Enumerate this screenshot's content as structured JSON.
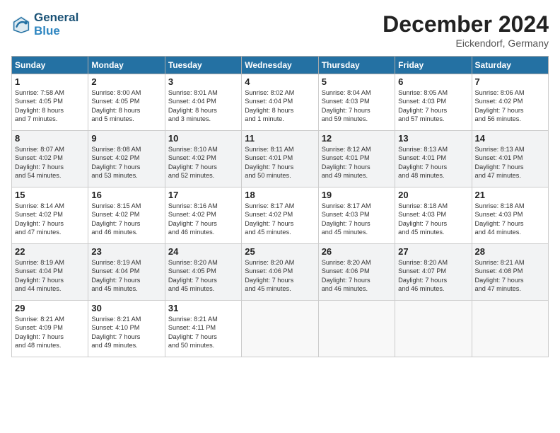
{
  "header": {
    "logo_line1": "General",
    "logo_line2": "Blue",
    "month": "December 2024",
    "location": "Eickendorf, Germany"
  },
  "days_of_week": [
    "Sunday",
    "Monday",
    "Tuesday",
    "Wednesday",
    "Thursday",
    "Friday",
    "Saturday"
  ],
  "weeks": [
    [
      {
        "day": 1,
        "info": "Sunrise: 7:58 AM\nSunset: 4:05 PM\nDaylight: 8 hours\nand 7 minutes."
      },
      {
        "day": 2,
        "info": "Sunrise: 8:00 AM\nSunset: 4:05 PM\nDaylight: 8 hours\nand 5 minutes."
      },
      {
        "day": 3,
        "info": "Sunrise: 8:01 AM\nSunset: 4:04 PM\nDaylight: 8 hours\nand 3 minutes."
      },
      {
        "day": 4,
        "info": "Sunrise: 8:02 AM\nSunset: 4:04 PM\nDaylight: 8 hours\nand 1 minute."
      },
      {
        "day": 5,
        "info": "Sunrise: 8:04 AM\nSunset: 4:03 PM\nDaylight: 7 hours\nand 59 minutes."
      },
      {
        "day": 6,
        "info": "Sunrise: 8:05 AM\nSunset: 4:03 PM\nDaylight: 7 hours\nand 57 minutes."
      },
      {
        "day": 7,
        "info": "Sunrise: 8:06 AM\nSunset: 4:02 PM\nDaylight: 7 hours\nand 56 minutes."
      }
    ],
    [
      {
        "day": 8,
        "info": "Sunrise: 8:07 AM\nSunset: 4:02 PM\nDaylight: 7 hours\nand 54 minutes."
      },
      {
        "day": 9,
        "info": "Sunrise: 8:08 AM\nSunset: 4:02 PM\nDaylight: 7 hours\nand 53 minutes."
      },
      {
        "day": 10,
        "info": "Sunrise: 8:10 AM\nSunset: 4:02 PM\nDaylight: 7 hours\nand 52 minutes."
      },
      {
        "day": 11,
        "info": "Sunrise: 8:11 AM\nSunset: 4:01 PM\nDaylight: 7 hours\nand 50 minutes."
      },
      {
        "day": 12,
        "info": "Sunrise: 8:12 AM\nSunset: 4:01 PM\nDaylight: 7 hours\nand 49 minutes."
      },
      {
        "day": 13,
        "info": "Sunrise: 8:13 AM\nSunset: 4:01 PM\nDaylight: 7 hours\nand 48 minutes."
      },
      {
        "day": 14,
        "info": "Sunrise: 8:13 AM\nSunset: 4:01 PM\nDaylight: 7 hours\nand 47 minutes."
      }
    ],
    [
      {
        "day": 15,
        "info": "Sunrise: 8:14 AM\nSunset: 4:02 PM\nDaylight: 7 hours\nand 47 minutes."
      },
      {
        "day": 16,
        "info": "Sunrise: 8:15 AM\nSunset: 4:02 PM\nDaylight: 7 hours\nand 46 minutes."
      },
      {
        "day": 17,
        "info": "Sunrise: 8:16 AM\nSunset: 4:02 PM\nDaylight: 7 hours\nand 46 minutes."
      },
      {
        "day": 18,
        "info": "Sunrise: 8:17 AM\nSunset: 4:02 PM\nDaylight: 7 hours\nand 45 minutes."
      },
      {
        "day": 19,
        "info": "Sunrise: 8:17 AM\nSunset: 4:03 PM\nDaylight: 7 hours\nand 45 minutes."
      },
      {
        "day": 20,
        "info": "Sunrise: 8:18 AM\nSunset: 4:03 PM\nDaylight: 7 hours\nand 45 minutes."
      },
      {
        "day": 21,
        "info": "Sunrise: 8:18 AM\nSunset: 4:03 PM\nDaylight: 7 hours\nand 44 minutes."
      }
    ],
    [
      {
        "day": 22,
        "info": "Sunrise: 8:19 AM\nSunset: 4:04 PM\nDaylight: 7 hours\nand 44 minutes."
      },
      {
        "day": 23,
        "info": "Sunrise: 8:19 AM\nSunset: 4:04 PM\nDaylight: 7 hours\nand 45 minutes."
      },
      {
        "day": 24,
        "info": "Sunrise: 8:20 AM\nSunset: 4:05 PM\nDaylight: 7 hours\nand 45 minutes."
      },
      {
        "day": 25,
        "info": "Sunrise: 8:20 AM\nSunset: 4:06 PM\nDaylight: 7 hours\nand 45 minutes."
      },
      {
        "day": 26,
        "info": "Sunrise: 8:20 AM\nSunset: 4:06 PM\nDaylight: 7 hours\nand 46 minutes."
      },
      {
        "day": 27,
        "info": "Sunrise: 8:20 AM\nSunset: 4:07 PM\nDaylight: 7 hours\nand 46 minutes."
      },
      {
        "day": 28,
        "info": "Sunrise: 8:21 AM\nSunset: 4:08 PM\nDaylight: 7 hours\nand 47 minutes."
      }
    ],
    [
      {
        "day": 29,
        "info": "Sunrise: 8:21 AM\nSunset: 4:09 PM\nDaylight: 7 hours\nand 48 minutes."
      },
      {
        "day": 30,
        "info": "Sunrise: 8:21 AM\nSunset: 4:10 PM\nDaylight: 7 hours\nand 49 minutes."
      },
      {
        "day": 31,
        "info": "Sunrise: 8:21 AM\nSunset: 4:11 PM\nDaylight: 7 hours\nand 50 minutes."
      },
      null,
      null,
      null,
      null
    ]
  ]
}
